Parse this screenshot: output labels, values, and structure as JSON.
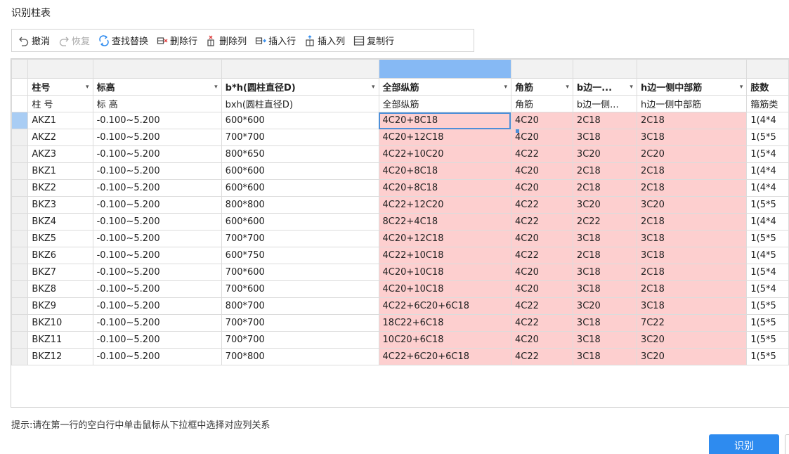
{
  "window": {
    "title": "识别柱表"
  },
  "toolbar": {
    "undo": "撤消",
    "redo": "恢复",
    "find_replace": "查找替换",
    "delete_row": "删除行",
    "delete_col": "删除列",
    "insert_row": "插入行",
    "insert_col": "插入列",
    "copy_row": "复制行"
  },
  "grid": {
    "headers": [
      "柱号",
      "标高",
      "b*h(圆柱直径D)",
      "全部纵筋",
      "角筋",
      "b边一...",
      "h边一侧中部筋",
      "肢数"
    ],
    "subheaders": [
      "柱 号",
      "标 高",
      "bxh(圆柱直径D)",
      "全部纵筋",
      "角筋",
      "b边一侧...",
      "h边一侧中部筋",
      "箍筋类"
    ],
    "rows": [
      [
        "AKZ1",
        "-0.100~5.200",
        "600*600",
        "4C20+8C18",
        "4C20",
        "2C18",
        "2C18",
        "1(4*4"
      ],
      [
        "AKZ2",
        "-0.100~5.200",
        "700*700",
        "4C20+12C18",
        "4C20",
        "3C18",
        "3C18",
        "1(5*5"
      ],
      [
        "AKZ3",
        "-0.100~5.200",
        "800*650",
        "4C22+10C20",
        "4C22",
        "3C20",
        "2C20",
        "1(5*4"
      ],
      [
        "BKZ1",
        "-0.100~5.200",
        "600*600",
        "4C20+8C18",
        "4C20",
        "2C18",
        "2C18",
        "1(4*4"
      ],
      [
        "BKZ2",
        "-0.100~5.200",
        "600*600",
        "4C20+8C18",
        "4C20",
        "2C18",
        "2C18",
        "1(4*4"
      ],
      [
        "BKZ3",
        "-0.100~5.200",
        "800*800",
        "4C22+12C20",
        "4C22",
        "3C20",
        "3C20",
        "1(5*5"
      ],
      [
        "BKZ4",
        "-0.100~5.200",
        "600*600",
        "8C22+4C18",
        "4C22",
        "2C22",
        "2C18",
        "1(4*4"
      ],
      [
        "BKZ5",
        "-0.100~5.200",
        "700*700",
        "4C20+12C18",
        "4C20",
        "3C18",
        "3C18",
        "1(5*5"
      ],
      [
        "BKZ6",
        "-0.100~5.200",
        "600*750",
        "4C22+10C18",
        "4C22",
        "2C18",
        "3C18",
        "1(4*5"
      ],
      [
        "BKZ7",
        "-0.100~5.200",
        "700*600",
        "4C20+10C18",
        "4C20",
        "3C18",
        "2C18",
        "1(5*4"
      ],
      [
        "BKZ8",
        "-0.100~5.200",
        "700*600",
        "4C20+10C18",
        "4C20",
        "3C18",
        "2C18",
        "1(5*4"
      ],
      [
        "BKZ9",
        "-0.100~5.200",
        "800*700",
        "4C22+6C20+6C18",
        "4C22",
        "3C20",
        "3C18",
        "1(5*5"
      ],
      [
        "BKZ10",
        "-0.100~5.200",
        "700*700",
        "18C22+6C18",
        "4C22",
        "3C18",
        "7C22",
        "1(5*5"
      ],
      [
        "BKZ11",
        "-0.100~5.200",
        "700*700",
        "10C20+6C18",
        "4C20",
        "3C18",
        "3C20",
        "1(5*5"
      ],
      [
        "BKZ12",
        "-0.100~5.200",
        "700*800",
        "4C22+6C20+6C18",
        "4C22",
        "3C18",
        "3C20",
        "1(5*5"
      ]
    ],
    "active_column": 3,
    "pink_columns": [
      3,
      4,
      5,
      6
    ]
  },
  "hint": "提示:请在第一行的空白行中单击鼠标从下拉框中选择对应列关系",
  "buttons": {
    "ok": "识别"
  },
  "colors": {
    "accent": "#2e8bef",
    "pink": "#fdcfcf",
    "active_header": "#86b9f4"
  }
}
